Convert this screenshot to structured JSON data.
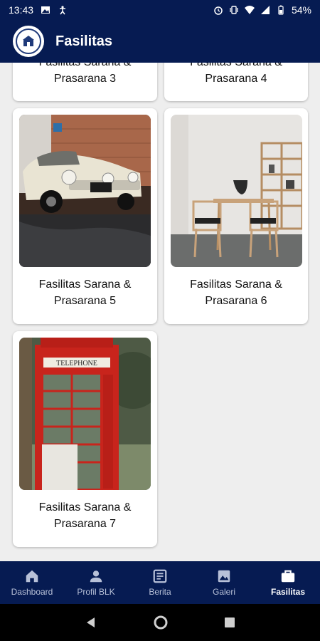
{
  "status_bar": {
    "time": "13:43",
    "battery": "54%",
    "icons": [
      "image-icon",
      "accessibility-icon",
      "alarm-icon",
      "vibrate-icon",
      "wifi-icon",
      "signal-icon",
      "battery-icon"
    ]
  },
  "app_bar": {
    "title": "Fasilitas",
    "logo": "blk-logo"
  },
  "cards": [
    {
      "line1": "Fasilitas Sarana &",
      "line2": "Prasarana 3"
    },
    {
      "line1": "Fasilitas Sarana &",
      "line2": "Prasarana 4"
    },
    {
      "line1": "Fasilitas Sarana &",
      "line2": "Prasarana 5",
      "image": "vintage-car-photo"
    },
    {
      "line1": "Fasilitas Sarana &",
      "line2": "Prasarana 6",
      "image": "dining-room-photo"
    },
    {
      "line1": "Fasilitas Sarana &",
      "line2": "Prasarana 7",
      "image": "telephone-booth-photo"
    }
  ],
  "bottom_nav": [
    {
      "label": "Dashboard",
      "icon": "home-icon",
      "active": false
    },
    {
      "label": "Profil BLK",
      "icon": "person-icon",
      "active": false
    },
    {
      "label": "Berita",
      "icon": "news-icon",
      "active": false
    },
    {
      "label": "Galeri",
      "icon": "image-icon",
      "active": false
    },
    {
      "label": "Fasilitas",
      "icon": "briefcase-icon",
      "active": true
    }
  ],
  "colors": {
    "primary": "#061b52",
    "background": "#eeeeee",
    "nav_inactive": "#b8c1d8",
    "nav_active": "#ffffff"
  }
}
